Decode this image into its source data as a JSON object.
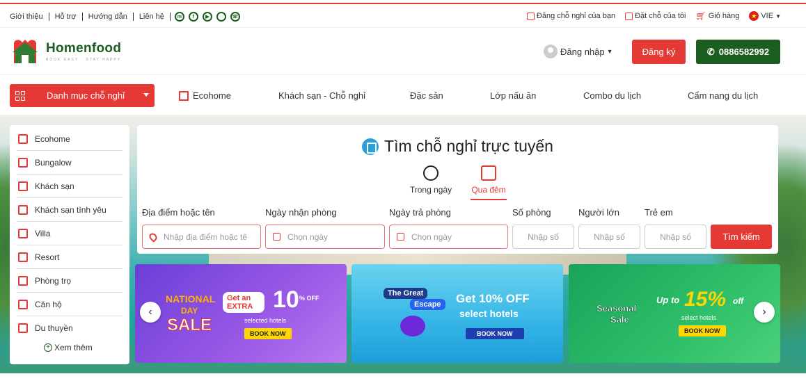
{
  "topbar": {
    "links": [
      "Giới thiệu",
      "Hỗ trợ",
      "Hướng dẫn",
      "Liên hệ"
    ],
    "social_icons": [
      "messenger-icon",
      "facebook-icon",
      "youtube-icon",
      "chat-icon",
      "whatsapp-icon"
    ],
    "right": {
      "list_property": "Đăng chỗ nghỉ của bạn",
      "my_bookings": "Đặt chỗ của tôi",
      "cart": "Giỏ hàng",
      "language": "VIE"
    }
  },
  "header": {
    "brand": "Homenfood",
    "tagline": "BOOK EASY · STAY HAPPY",
    "login": "Đăng nhập",
    "register": "Đăng ký",
    "phone": "0886582992"
  },
  "nav": {
    "category_button": "Danh mục chỗ nghỉ",
    "items": [
      "Ecohome",
      "Khách sạn - Chỗ nghỉ",
      "Đặc sản",
      "Lớp nấu ăn",
      "Combo du lịch",
      "Cẩm nang du lịch"
    ]
  },
  "sidebar": {
    "items": [
      "Ecohome",
      "Bungalow",
      "Khách sạn",
      "Khách sạn tình yêu",
      "Villa",
      "Resort",
      "Phòng trọ",
      "Căn hộ",
      "Du thuyền"
    ],
    "more": "Xem thêm"
  },
  "search": {
    "title": "Tìm chỗ nghỉ trực tuyến",
    "tabs": [
      "Trong ngày",
      "Qua đêm"
    ],
    "active_tab": "Qua đêm",
    "labels": {
      "location": "Địa điểm hoặc tên",
      "checkin": "Ngày nhận phòng",
      "checkout": "Ngày trả phòng",
      "rooms": "Số phòng",
      "adults": "Người lớn",
      "children": "Trẻ em"
    },
    "placeholders": {
      "location": "Nhập địa điểm hoặc tê",
      "checkin": "Chọn ngày",
      "checkout": "Chọn ngày",
      "rooms": "Nhập số",
      "adults": "Nhập số",
      "children": "Nhập số"
    },
    "submit": "Tìm kiếm"
  },
  "banners": [
    {
      "l1": "NATIONAL",
      "l2": "DAY",
      "l3": "SALE",
      "offer": "Get an EXTRA",
      "pct": "10",
      "unit": "% OFF",
      "sub": "selected hotels",
      "cta": "BOOK NOW"
    },
    {
      "l1": "The Great",
      "l2": "Escape",
      "offer": "Get 10% OFF",
      "sub": "select hotels",
      "cta": "BOOK NOW"
    },
    {
      "l1": "Seasonal",
      "l2": "Sale",
      "offer": "Up to",
      "pct": "15%",
      "unit": "off",
      "sub": "select hotels",
      "cta": "BOOK NOW"
    }
  ],
  "colors": {
    "brand_red": "#e53935",
    "brand_green": "#1b5e20"
  }
}
